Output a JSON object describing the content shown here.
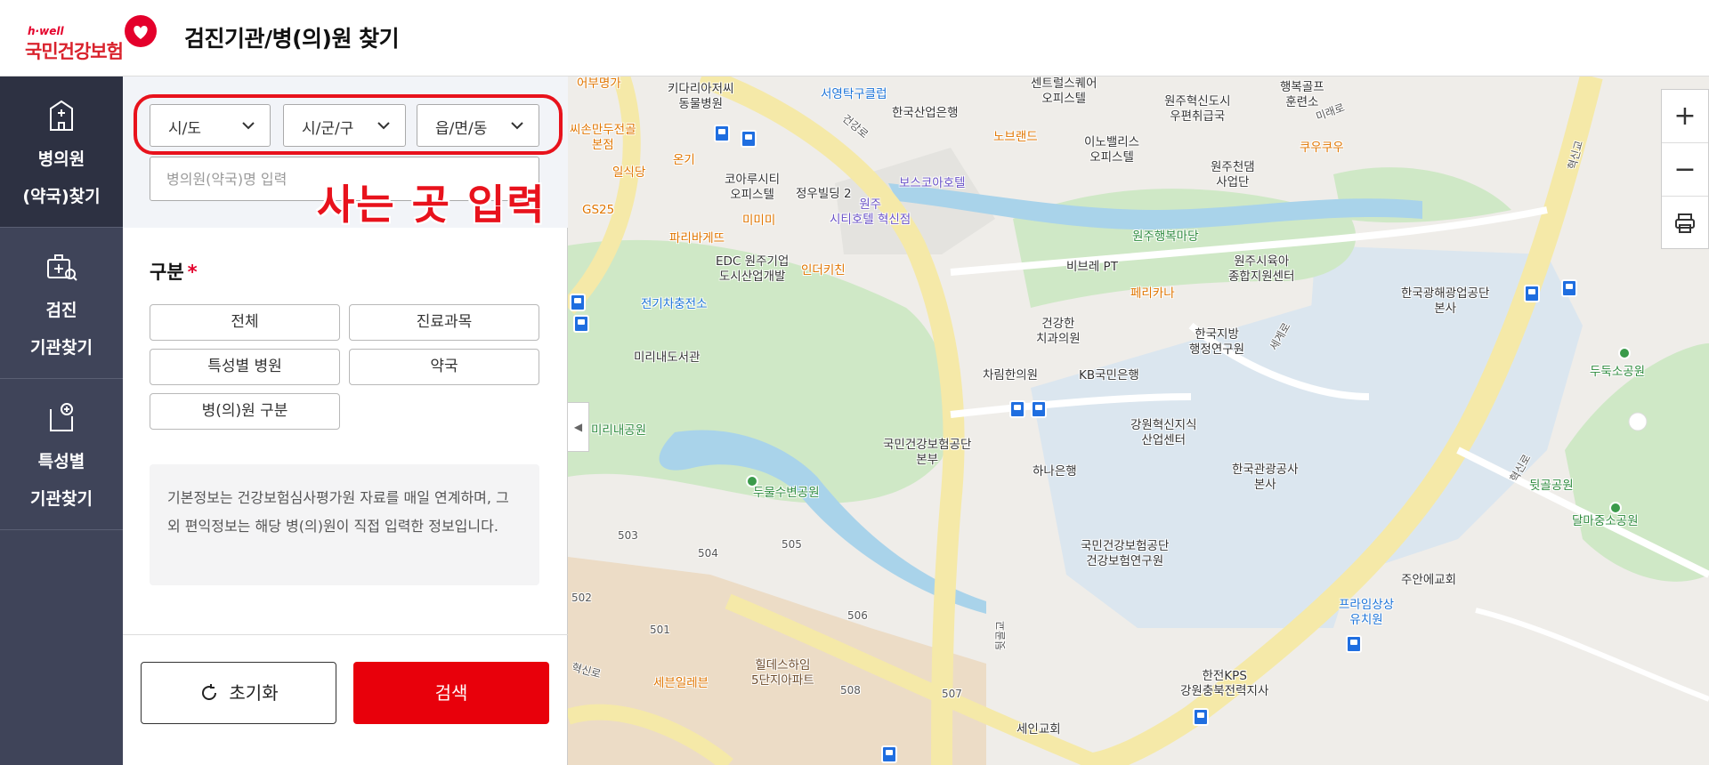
{
  "header": {
    "logo_sub": "h·well",
    "logo_main": "국민건강보험",
    "title": "검진기관/병(의)원 찾기"
  },
  "nav": {
    "items": [
      {
        "line1": "병의원",
        "line2": "(약국)찾기",
        "icon": "hospital-building-icon",
        "active": true
      },
      {
        "line1": "검진",
        "line2": "기관찾기",
        "icon": "medical-bag-search-icon",
        "active": false
      },
      {
        "line1": "특성별",
        "line2": "기관찾기",
        "icon": "clipboard-plus-icon",
        "active": false
      }
    ]
  },
  "search": {
    "select_sido": "시/도",
    "select_sigungu": "시/군/구",
    "select_eupmyeon": "읍/면/동",
    "name_placeholder": "병의원(약국)명 입력",
    "annotation": "사는 곳 입력"
  },
  "category": {
    "title": "구분",
    "required_mark": "*",
    "buttons": [
      "전체",
      "진료과목",
      "특성별 병원",
      "약국",
      "병(의)원 구분"
    ]
  },
  "info": {
    "text": "기본정보는 건강보험심사평가원 자료를 매일 연계하며, 그 외 편익정보는 해당 병(의)원이 직접 입력한 정보입니다."
  },
  "actions": {
    "reset_label": "초기화",
    "search_label": "검색"
  },
  "map": {
    "zoom_in": "+",
    "zoom_out": "−",
    "print_icon": "printer-icon",
    "collapse_icon": "chevron-left-icon",
    "pois": [
      {
        "text": "어부명가",
        "cls": "orange"
      },
      {
        "text": "키다리아저씨\n동물병원",
        "cls": ""
      },
      {
        "text": "서영탁구클럽",
        "cls": "blue"
      },
      {
        "text": "한국산업은행",
        "cls": ""
      },
      {
        "text": "센트럴스퀘어\n오피스텔",
        "cls": ""
      },
      {
        "text": "원주혁신도시\n우편취급국",
        "cls": ""
      },
      {
        "text": "행복골프\n훈련소",
        "cls": ""
      },
      {
        "text": "씨손만두전골\n본점",
        "cls": "orange"
      },
      {
        "text": "온기",
        "cls": "orange"
      },
      {
        "text": "노브랜드",
        "cls": "orange"
      },
      {
        "text": "이노밸리스\n오피스텔",
        "cls": ""
      },
      {
        "text": "원주천댐\n사업단",
        "cls": ""
      },
      {
        "text": "쿠우쿠우",
        "cls": "orange"
      },
      {
        "text": "일식당",
        "cls": "orange"
      },
      {
        "text": "코아루시티\n오피스텔",
        "cls": ""
      },
      {
        "text": "정우빌딩 2",
        "cls": ""
      },
      {
        "text": "원주\n시티호텔 혁신점",
        "cls": "purple"
      },
      {
        "text": "보스코아호텔",
        "cls": "purple"
      },
      {
        "text": "GS25",
        "cls": "orange"
      },
      {
        "text": "파리바게뜨",
        "cls": "orange"
      },
      {
        "text": "미미미",
        "cls": "orange"
      },
      {
        "text": "원주행복마당",
        "cls": "green"
      },
      {
        "text": "EDC 원주기업\n도시산업개발",
        "cls": ""
      },
      {
        "text": "인더키친",
        "cls": "orange"
      },
      {
        "text": "비브레 PT",
        "cls": ""
      },
      {
        "text": "원주시육아\n종합지원센터",
        "cls": ""
      },
      {
        "text": "전기차충전소",
        "cls": "blue"
      },
      {
        "text": "페리카나",
        "cls": "orange"
      },
      {
        "text": "한국광해광업공단\n본사",
        "cls": ""
      },
      {
        "text": "건강한\n치과의원",
        "cls": ""
      },
      {
        "text": "한국지방\n행정연구원",
        "cls": ""
      },
      {
        "text": "미리내도서관",
        "cls": ""
      },
      {
        "text": "차림한의원",
        "cls": ""
      },
      {
        "text": "KB국민은행",
        "cls": ""
      },
      {
        "text": "두둑소공원",
        "cls": "green"
      },
      {
        "text": "강원혁신지식\n산업센터",
        "cls": ""
      },
      {
        "text": "미리내공원",
        "cls": "green"
      },
      {
        "text": "국민건강보험공단\n본부",
        "cls": ""
      },
      {
        "text": "하나은행",
        "cls": ""
      },
      {
        "text": "한국관광공사\n본사",
        "cls": ""
      },
      {
        "text": "두물수변공원",
        "cls": "green"
      },
      {
        "text": "뒷골공원",
        "cls": "green"
      },
      {
        "text": "달마중소공원",
        "cls": "green"
      },
      {
        "text": "국민건강보험공단\n건강보험연구원",
        "cls": ""
      },
      {
        "text": "주안에교회",
        "cls": ""
      },
      {
        "text": "프라임상상\n유치원",
        "cls": "blue"
      },
      {
        "text": "힐데스하임\n5단지아파트",
        "cls": "brown"
      },
      {
        "text": "세븐일레븐",
        "cls": "orange"
      },
      {
        "text": "한전KPS\n강원충북전력지사",
        "cls": ""
      },
      {
        "text": "세인교회",
        "cls": ""
      },
      {
        "text": "503",
        "cls": "small"
      },
      {
        "text": "504",
        "cls": "small"
      },
      {
        "text": "505",
        "cls": "small"
      },
      {
        "text": "502",
        "cls": "small"
      },
      {
        "text": "501",
        "cls": "small"
      },
      {
        "text": "506",
        "cls": "small"
      },
      {
        "text": "508",
        "cls": "small"
      },
      {
        "text": "507",
        "cls": "small"
      },
      {
        "text": "건강로",
        "cls": "small"
      },
      {
        "text": "혁신로",
        "cls": "small"
      },
      {
        "text": "세계로",
        "cls": "small"
      },
      {
        "text": "미래로",
        "cls": "small"
      },
      {
        "text": "뒷골교",
        "cls": "small"
      },
      {
        "text": "혁신로",
        "cls": "small"
      },
      {
        "text": "혁신교",
        "cls": "small"
      }
    ]
  },
  "colors": {
    "brand_red": "#e8000b",
    "nav_bg": "#3f4459",
    "nav_active": "#2d3142",
    "annotation_red": "#e8121c"
  }
}
